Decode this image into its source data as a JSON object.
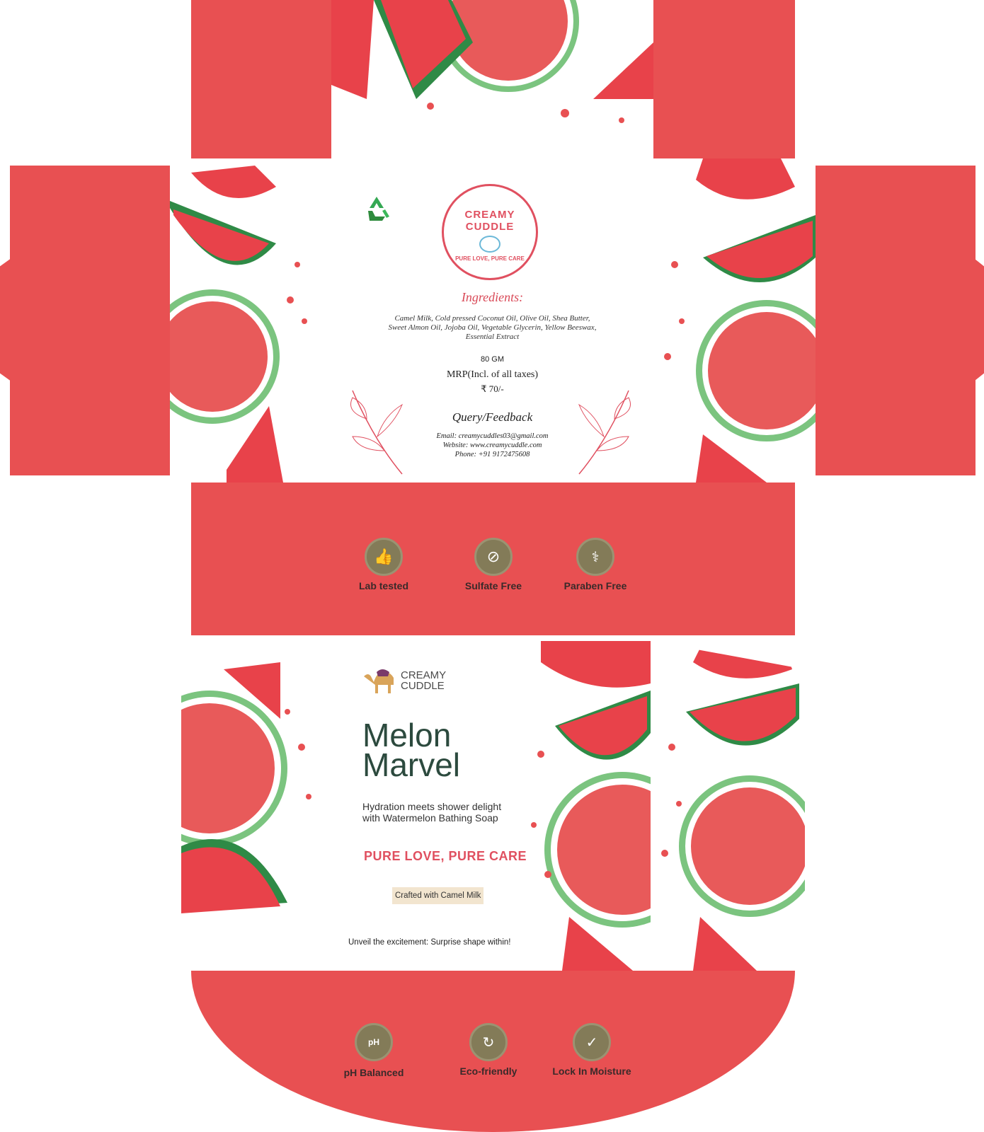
{
  "colors": {
    "box_red": "#e85052",
    "melon_red": "#e8424a",
    "rind_green": "#2f8a46",
    "light_green": "#7bc47f",
    "badge": "#837b58",
    "title": "#2c4a3e",
    "accent": "#e05060"
  },
  "logo_seal": {
    "brand": "CREAMY CUDDLE",
    "tagline": "PURE LOVE, PURE CARE",
    "icon": "recycle-icon"
  },
  "back_panel": {
    "ingredients_heading": "Ingredients:",
    "ingredients_line1": "Camel Milk, Cold pressed Coconut Oil, Olive Oil, Shea Butter,",
    "ingredients_line2": "Sweet Almon Oil, Jojoba Oil, Vegetable Glycerin, Yellow Beeswax,",
    "ingredients_line3": "Essential Extract",
    "weight": "80 GM",
    "mrp_label": "MRP(Incl. of all taxes)",
    "price": "₹ 70/-",
    "query_heading": "Query/Feedback",
    "email": "Email: creamycuddles03@gmail.com",
    "website": "Website: www.creamycuddle.com",
    "phone": "Phone: +91 9172475608"
  },
  "badges_top": [
    {
      "label": "Lab tested",
      "icon": "thumbs-up-icon"
    },
    {
      "label": "Sulfate Free",
      "icon": "no-leaf-icon"
    },
    {
      "label": "Paraben Free",
      "icon": "flask-icon"
    }
  ],
  "front_panel": {
    "brand_line1": "CREAMY",
    "brand_line2": "CUDDLE",
    "logo_icon": "camel-icon",
    "title_line1": "Melon",
    "title_line2": "Marvel",
    "subtitle_line1": "Hydration meets shower delight",
    "subtitle_line2": "with Watermelon Bathing Soap",
    "tagline": "PURE LOVE, PURE CARE",
    "crafted": "Crafted with Camel Milk",
    "surprise": "Unveil the excitement: Surprise shape within!"
  },
  "badges_bottom": [
    {
      "label": "pH Balanced",
      "icon": "ph-drop-icon"
    },
    {
      "label": "Eco-friendly",
      "icon": "eco-cycle-icon"
    },
    {
      "label": "Lock In Moisture",
      "icon": "moisture-check-icon"
    }
  ]
}
